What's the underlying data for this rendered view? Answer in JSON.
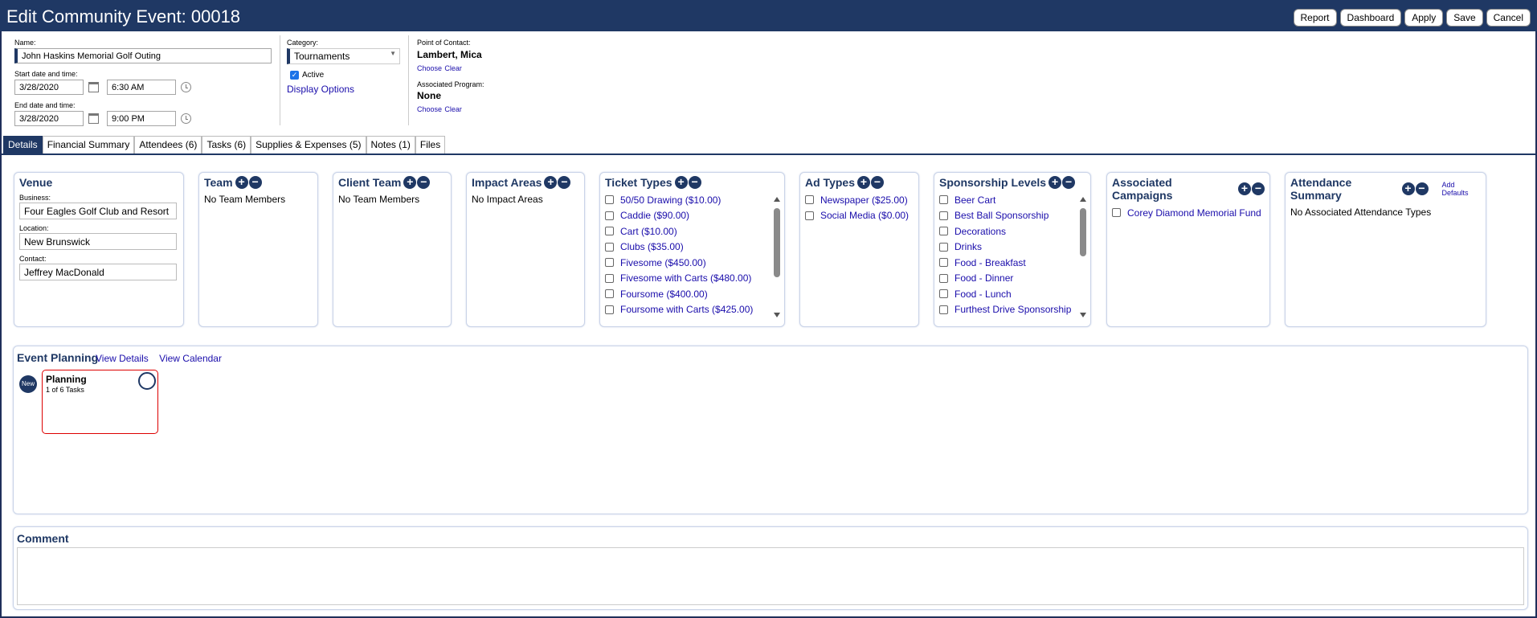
{
  "window": {
    "title": "Edit Community Event: 00018",
    "buttons": [
      "Report",
      "Dashboard",
      "Apply",
      "Save",
      "Cancel"
    ]
  },
  "form": {
    "name_label": "Name:",
    "name_value": "John Haskins Memorial Golf Outing",
    "start_label": "Start date and time:",
    "start_date": "3/28/2020",
    "start_time": "6:30 AM",
    "end_label": "End date and time:",
    "end_date": "3/28/2020",
    "end_time": "9:00 PM",
    "category_label": "Category:",
    "category_value": "Tournaments",
    "active_label": "Active",
    "active_checked": true,
    "display_options": "Display Options",
    "poc_label": "Point of Contact:",
    "poc_value": "Lambert, Mica",
    "poc_choose": "Choose",
    "poc_clear": "Clear",
    "program_label": "Associated Program:",
    "program_value": "None",
    "program_choose": "Choose",
    "program_clear": "Clear"
  },
  "tabs": [
    {
      "label": "Details",
      "active": true
    },
    {
      "label": "Financial Summary"
    },
    {
      "label": "Attendees (6)"
    },
    {
      "label": "Tasks (6)"
    },
    {
      "label": "Supplies & Expenses (5)"
    },
    {
      "label": "Notes (1)"
    },
    {
      "label": "Files"
    }
  ],
  "venue": {
    "title": "Venue",
    "business_label": "Business:",
    "business_value": "Four Eagles Golf Club and Resort",
    "location_label": "Location:",
    "location_value": "New Brunswick",
    "contact_label": "Contact:",
    "contact_value": "Jeffrey MacDonald"
  },
  "team": {
    "title": "Team",
    "empty": "No Team Members"
  },
  "client_team": {
    "title": "Client Team",
    "empty": "No Team Members"
  },
  "impact_areas": {
    "title": "Impact Areas",
    "empty": "No Impact Areas"
  },
  "ticket_types": {
    "title": "Ticket Types",
    "items": [
      "50/50 Drawing ($10.00)",
      "Caddie ($90.00)",
      "Cart ($10.00)",
      "Clubs ($35.00)",
      "Fivesome ($450.00)",
      "Fivesome with Carts ($480.00)",
      "Foursome ($400.00)",
      "Foursome with Carts ($425.00)"
    ]
  },
  "ad_types": {
    "title": "Ad Types",
    "items": [
      "Newspaper ($25.00)",
      "Social Media ($0.00)"
    ]
  },
  "sponsorship": {
    "title": "Sponsorship Levels",
    "items": [
      "Beer Cart",
      "Best Ball Sponsorship",
      "Decorations",
      "Drinks",
      "Food - Breakfast",
      "Food - Dinner",
      "Food - Lunch",
      "Furthest Drive Sponsorship"
    ]
  },
  "campaigns": {
    "title": "Associated Campaigns",
    "items": [
      "Corey Diamond Memorial Fund"
    ]
  },
  "attendance": {
    "title": "Attendance Summary",
    "add_defaults": "Add Defaults",
    "empty": "No Associated Attendance Types"
  },
  "planning": {
    "title": "Event Planning",
    "view_details": "View Details",
    "view_calendar": "View Calendar",
    "badge": "New",
    "card_title": "Planning",
    "card_sub": "1 of 6 Tasks"
  },
  "comment": {
    "title": "Comment",
    "value": ""
  },
  "colors": {
    "navy": "#1f3864",
    "link": "#1a0dab",
    "alert": "#dd0000"
  }
}
